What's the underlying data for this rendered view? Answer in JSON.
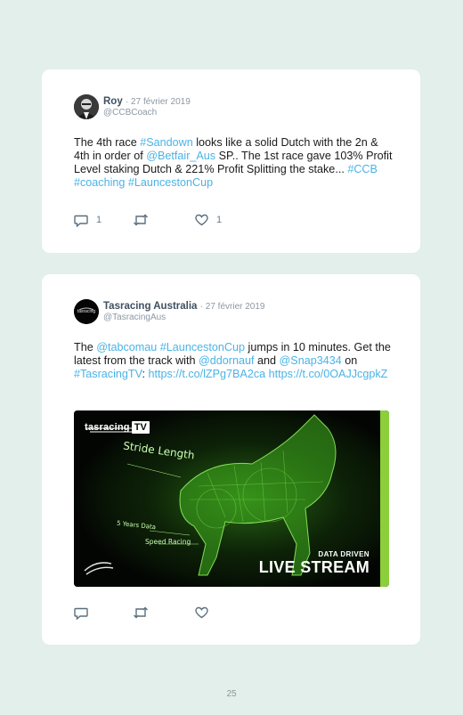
{
  "tweets": [
    {
      "name": "Roy",
      "date": "· 27 février 2019",
      "handle": "@CCBCoach",
      "text_parts": [
        {
          "t": "The 4th race ",
          "link": false
        },
        {
          "t": "#Sandown",
          "link": true
        },
        {
          "t": " looks like a solid Dutch with the 2n & 4th in order of ",
          "link": false
        },
        {
          "t": "@Betfair_Aus",
          "link": true
        },
        {
          "t": " SP.. The 1st race gave 103% Profit Level staking Dutch & 221% Profit Splitting the stake... ",
          "link": false
        },
        {
          "t": "#CCB",
          "link": true
        },
        {
          "t": " ",
          "link": false
        },
        {
          "t": "#coaching",
          "link": true
        },
        {
          "t": " ",
          "link": false
        },
        {
          "t": "#LauncestonCup",
          "link": true
        }
      ],
      "reply_count": "1",
      "like_count": "1"
    },
    {
      "name": "Tasracing Australia",
      "date": "· 27 février 2019",
      "handle": "@TasracingAus",
      "avatar_text": "tasracing",
      "text_parts": [
        {
          "t": "The ",
          "link": false
        },
        {
          "t": "@tabcomau",
          "link": true
        },
        {
          "t": " ",
          "link": false
        },
        {
          "t": "#LauncestonCup",
          "link": true
        },
        {
          "t": " jumps in 10 minutes. Get the latest from the track with ",
          "link": false
        },
        {
          "t": "@ddornauf",
          "link": true
        },
        {
          "t": " and ",
          "link": false
        },
        {
          "t": "@Snap3434",
          "link": true
        },
        {
          "t": " on ",
          "link": false
        },
        {
          "t": "#TasracingTV",
          "link": true
        },
        {
          "t": ": ",
          "link": false
        },
        {
          "t": "https://t.co/lZPg7BA2ca",
          "link": true
        },
        {
          "t": " ",
          "link": false
        },
        {
          "t": "https://t.co/0OAJJcgpkZ",
          "link": true
        }
      ],
      "reply_count": "",
      "like_count": "",
      "media": {
        "brand": "tasracing",
        "brand_tv": "TV",
        "label_stride": "Stride Length",
        "label_years": "5 Years Data",
        "label_speed": "Speed Racing",
        "small_caption": "DATA DRIVEN",
        "big_caption": "LIVE STREAM"
      }
    }
  ],
  "page_number": "25",
  "colors": {
    "background": "#e2efea",
    "link": "#4ab3e6",
    "icon": "#5a6f7f"
  }
}
